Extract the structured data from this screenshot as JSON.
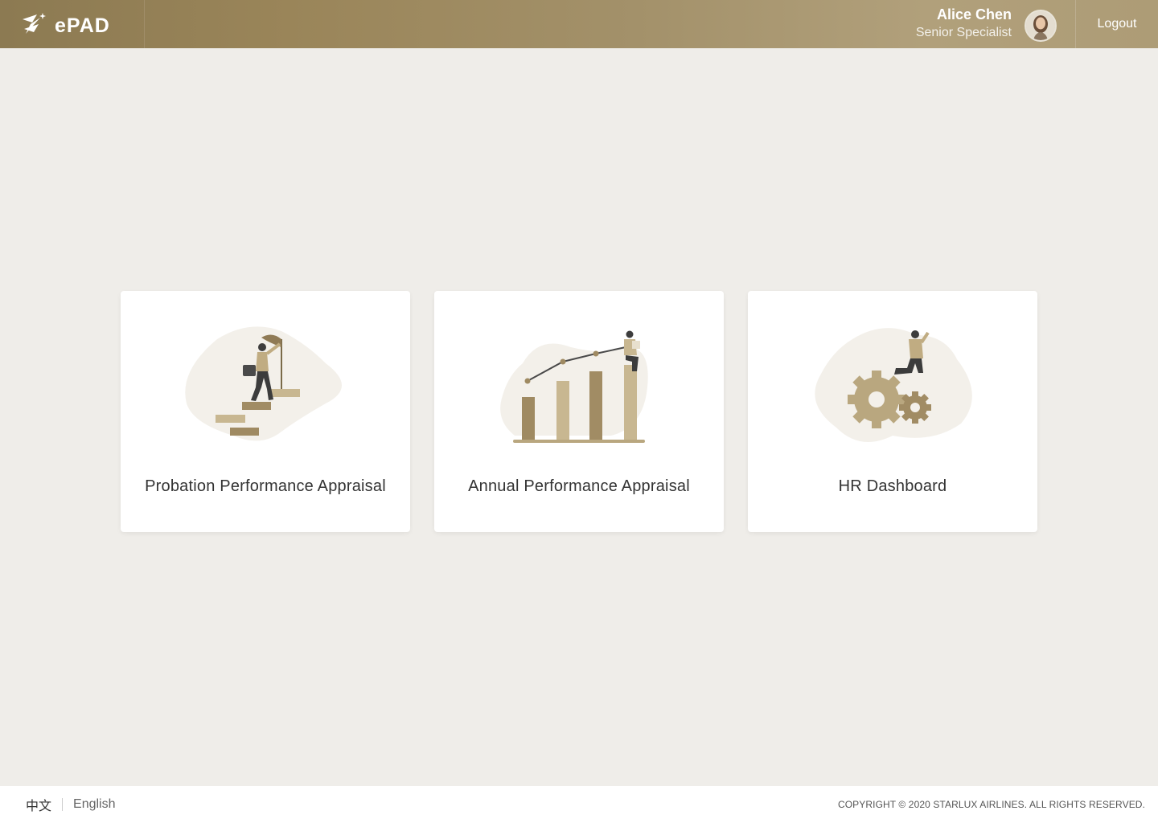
{
  "header": {
    "logo_text": "ePAD",
    "user": {
      "name": "Alice Chen",
      "role": "Senior Specialist"
    },
    "logout_label": "Logout"
  },
  "cards": [
    {
      "title": "Probation Performance Appraisal",
      "illustration": "climbing-stairs-flag-illustration"
    },
    {
      "title": "Annual Performance Appraisal",
      "illustration": "growth-bar-chart-illustration"
    },
    {
      "title": "HR Dashboard",
      "illustration": "gears-person-illustration"
    }
  ],
  "footer": {
    "lang_zh": "中文",
    "lang_en": "English",
    "copyright": "COPYRIGHT © 2020 STARLUX AIRLINES. ALL RIGHTS RESERVED."
  },
  "colors": {
    "header_start": "#8c7a52",
    "header_end": "#b1a07b",
    "background": "#efede9",
    "accent": "#b2a07a"
  }
}
